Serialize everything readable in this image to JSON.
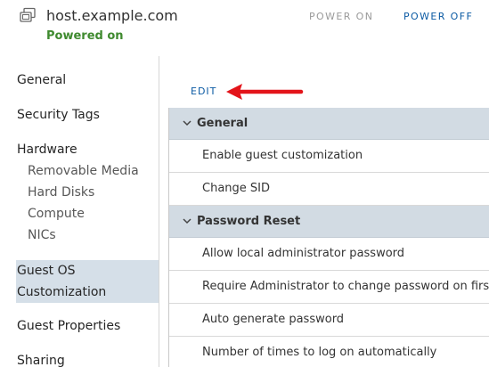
{
  "header": {
    "vm_name": "host.example.com",
    "status": "Powered on",
    "power_on_label": "POWER ON",
    "power_off_label": "POWER OFF"
  },
  "sidebar": {
    "items": [
      {
        "label": "General"
      },
      {
        "label": "Security Tags"
      },
      {
        "label": "Hardware"
      },
      {
        "label": "Removable Media"
      },
      {
        "label": "Hard Disks"
      },
      {
        "label": "Compute"
      },
      {
        "label": "NICs"
      },
      {
        "label_line1": "Guest OS",
        "label_line2": "Customization",
        "selected": true
      },
      {
        "label": "Guest Properties"
      },
      {
        "label": "Sharing"
      }
    ]
  },
  "main": {
    "edit_label": "EDIT",
    "sections": [
      {
        "title": "General",
        "rows": [
          "Enable guest customization",
          "Change SID"
        ]
      },
      {
        "title": "Password Reset",
        "rows": [
          "Allow local administrator password",
          "Require Administrator to change password on first l",
          "Auto generate password",
          "Number of times to log on automatically"
        ]
      }
    ]
  },
  "colors": {
    "accent": "#0b5aa3",
    "status_green": "#3f8a2f",
    "selected_bg": "#d5dfe8",
    "section_bg": "#d2dbe3",
    "arrow_red": "#e3141a"
  },
  "icons": {
    "vm": "virtual-machine-icon",
    "chevron": "chevron-down-icon",
    "arrow": "red-arrow-icon"
  }
}
